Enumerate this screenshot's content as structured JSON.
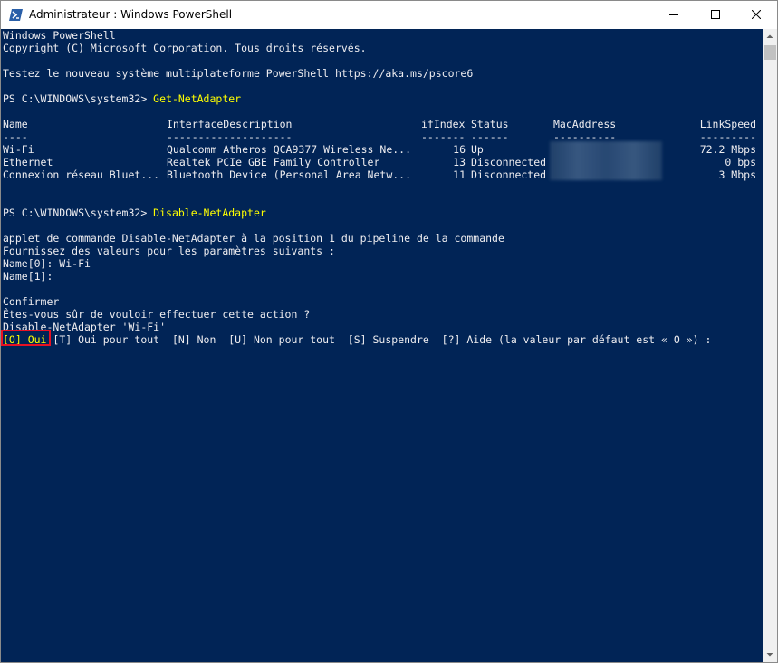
{
  "window": {
    "title": "Administrateur : Windows PowerShell",
    "icon": "powershell-icon",
    "controls": [
      "minimize-icon",
      "maximize-icon",
      "close-icon"
    ]
  },
  "colors": {
    "console_bg": "#012456",
    "text": "#eeedf0",
    "command": "#ffff00",
    "highlight_border": "#e81123"
  },
  "console": {
    "header1": "Windows PowerShell",
    "header2": "Copyright (C) Microsoft Corporation. Tous droits réservés.",
    "header3": "Testez le nouveau système multiplateforme PowerShell https://aka.ms/pscore6",
    "prompt1": "PS C:\\WINDOWS\\system32> ",
    "command1": "Get-NetAdapter",
    "table": {
      "headers": {
        "name": "Name",
        "desc": "InterfaceDescription",
        "ifindex": "ifIndex",
        "status": "Status",
        "mac": "MacAddress",
        "speed": "LinkSpeed"
      },
      "dashes": {
        "name": "----",
        "desc": "--------------------",
        "ifindex": "-------",
        "status": "------",
        "mac": "----------",
        "speed": "---------"
      },
      "rows": [
        {
          "name": "Wi-Fi",
          "desc": "Qualcomm Atheros QCA9377 Wireless Ne...",
          "ifindex": "16",
          "status": "Up",
          "speed": "72.2 Mbps"
        },
        {
          "name": "Ethernet",
          "desc": "Realtek PCIe GBE Family Controller",
          "ifindex": "13",
          "status": "Disconnected",
          "speed": "0 bps"
        },
        {
          "name": "Connexion réseau Bluet...",
          "desc": "Bluetooth Device (Personal Area Netw...",
          "ifindex": "11",
          "status": "Disconnected",
          "speed": "3 Mbps"
        }
      ]
    },
    "prompt2": "PS C:\\WINDOWS\\system32> ",
    "command2": "Disable-NetAdapter",
    "msg1": "applet de commande Disable-NetAdapter à la position 1 du pipeline de la commande",
    "msg2": "Fournissez des valeurs pour les paramètres suivants :",
    "msg3": "Name[0]: Wi-Fi",
    "msg4": "Name[1]:",
    "confirm1": "Confirmer",
    "confirm2": "Êtes-vous sûr de vouloir effectuer cette action ?",
    "confirm3": "Disable-NetAdapter 'Wi-Fi'",
    "choice_default": "[O] Oui",
    "choices_rest": " [T] Oui pour tout  [N] Non  [U] Non pour tout  [S] Suspendre  [?] Aide (la valeur par défaut est « O ») :"
  }
}
